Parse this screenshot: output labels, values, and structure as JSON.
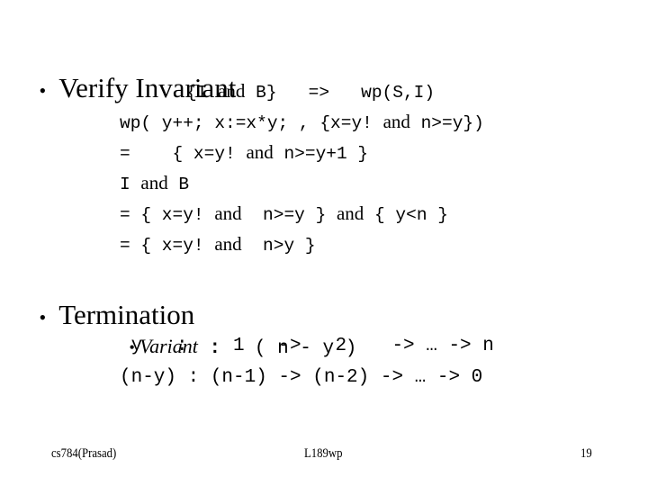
{
  "slide": {
    "bullet_glyph": "•",
    "sections": [
      {
        "heading": "Verify Invariant",
        "lines": [
          {
            "segments": [
              {
                "t": "{I ",
                "m": true
              },
              {
                "t": "and",
                "m": false
              },
              {
                "t": " B}   =>   wp(S,I)",
                "m": true
              }
            ]
          },
          {
            "segments": [
              {
                "t": "wp( y++; x:=x*y; , {x=y! ",
                "m": true
              },
              {
                "t": "and",
                "m": false
              },
              {
                "t": " n>=y})",
                "m": true
              }
            ]
          },
          {
            "segments": [
              {
                "t": "=    { x=y! ",
                "m": true
              },
              {
                "t": "and",
                "m": false
              },
              {
                "t": " n>=y+1 }",
                "m": true
              }
            ]
          },
          {
            "segments": [
              {
                "t": "I ",
                "m": true
              },
              {
                "t": "and",
                "m": false
              },
              {
                "t": " B",
                "m": true
              }
            ]
          },
          {
            "segments": [
              {
                "t": "= { x=y! ",
                "m": true
              },
              {
                "t": "and",
                "m": false
              },
              {
                "t": "  n>=y } ",
                "m": true
              },
              {
                "t": "and",
                "m": false
              },
              {
                "t": " { y<n }",
                "m": true
              }
            ]
          },
          {
            "segments": [
              {
                "t": "= { x=y! ",
                "m": true
              },
              {
                "t": "and",
                "m": false
              },
              {
                "t": "  n>y }",
                "m": true
              }
            ]
          }
        ]
      },
      {
        "heading": "Termination",
        "sub_bullet": {
          "label": "Variant",
          "separator": " :",
          "expr": "   ( n - y )"
        },
        "lines": [
          " y   :    1   ->   2    -> … -> n",
          "(n-y) : (n-1) -> (n-2) -> … -> 0"
        ]
      }
    ]
  },
  "footer": {
    "left": "cs784(Prasad)",
    "center": "L189wp",
    "page_number": "19"
  }
}
